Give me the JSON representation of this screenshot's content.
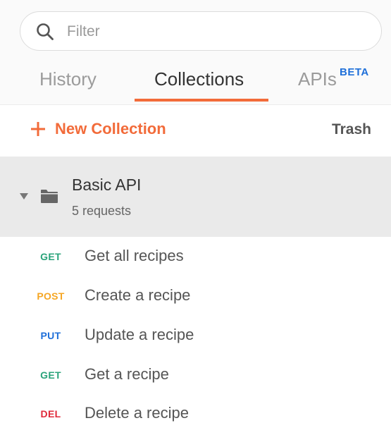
{
  "search": {
    "placeholder": "Filter",
    "value": ""
  },
  "tabs": [
    {
      "label": "History"
    },
    {
      "label": "Collections"
    },
    {
      "label": "APIs",
      "badge": "BETA"
    }
  ],
  "toolbar": {
    "new_collection_label": "New Collection",
    "trash_label": "Trash"
  },
  "collection": {
    "name": "Basic API",
    "count_text": "5 requests"
  },
  "requests": [
    {
      "method": "GET",
      "name": "Get all recipes",
      "color": "#2aa37a"
    },
    {
      "method": "POST",
      "name": "Create a recipe",
      "color": "#f5a623"
    },
    {
      "method": "PUT",
      "name": "Update a recipe",
      "color": "#1e6fd9"
    },
    {
      "method": "GET",
      "name": "Get a recipe",
      "color": "#2aa37a"
    },
    {
      "method": "DEL",
      "name": "Delete a recipe",
      "color": "#e0293a"
    }
  ],
  "colors": {
    "accent": "#f26b3a",
    "beta": "#1e6fd9"
  },
  "icons": {
    "search": "search-icon",
    "plus": "plus-icon",
    "caret": "caret-down-icon",
    "folder": "folder-icon"
  }
}
